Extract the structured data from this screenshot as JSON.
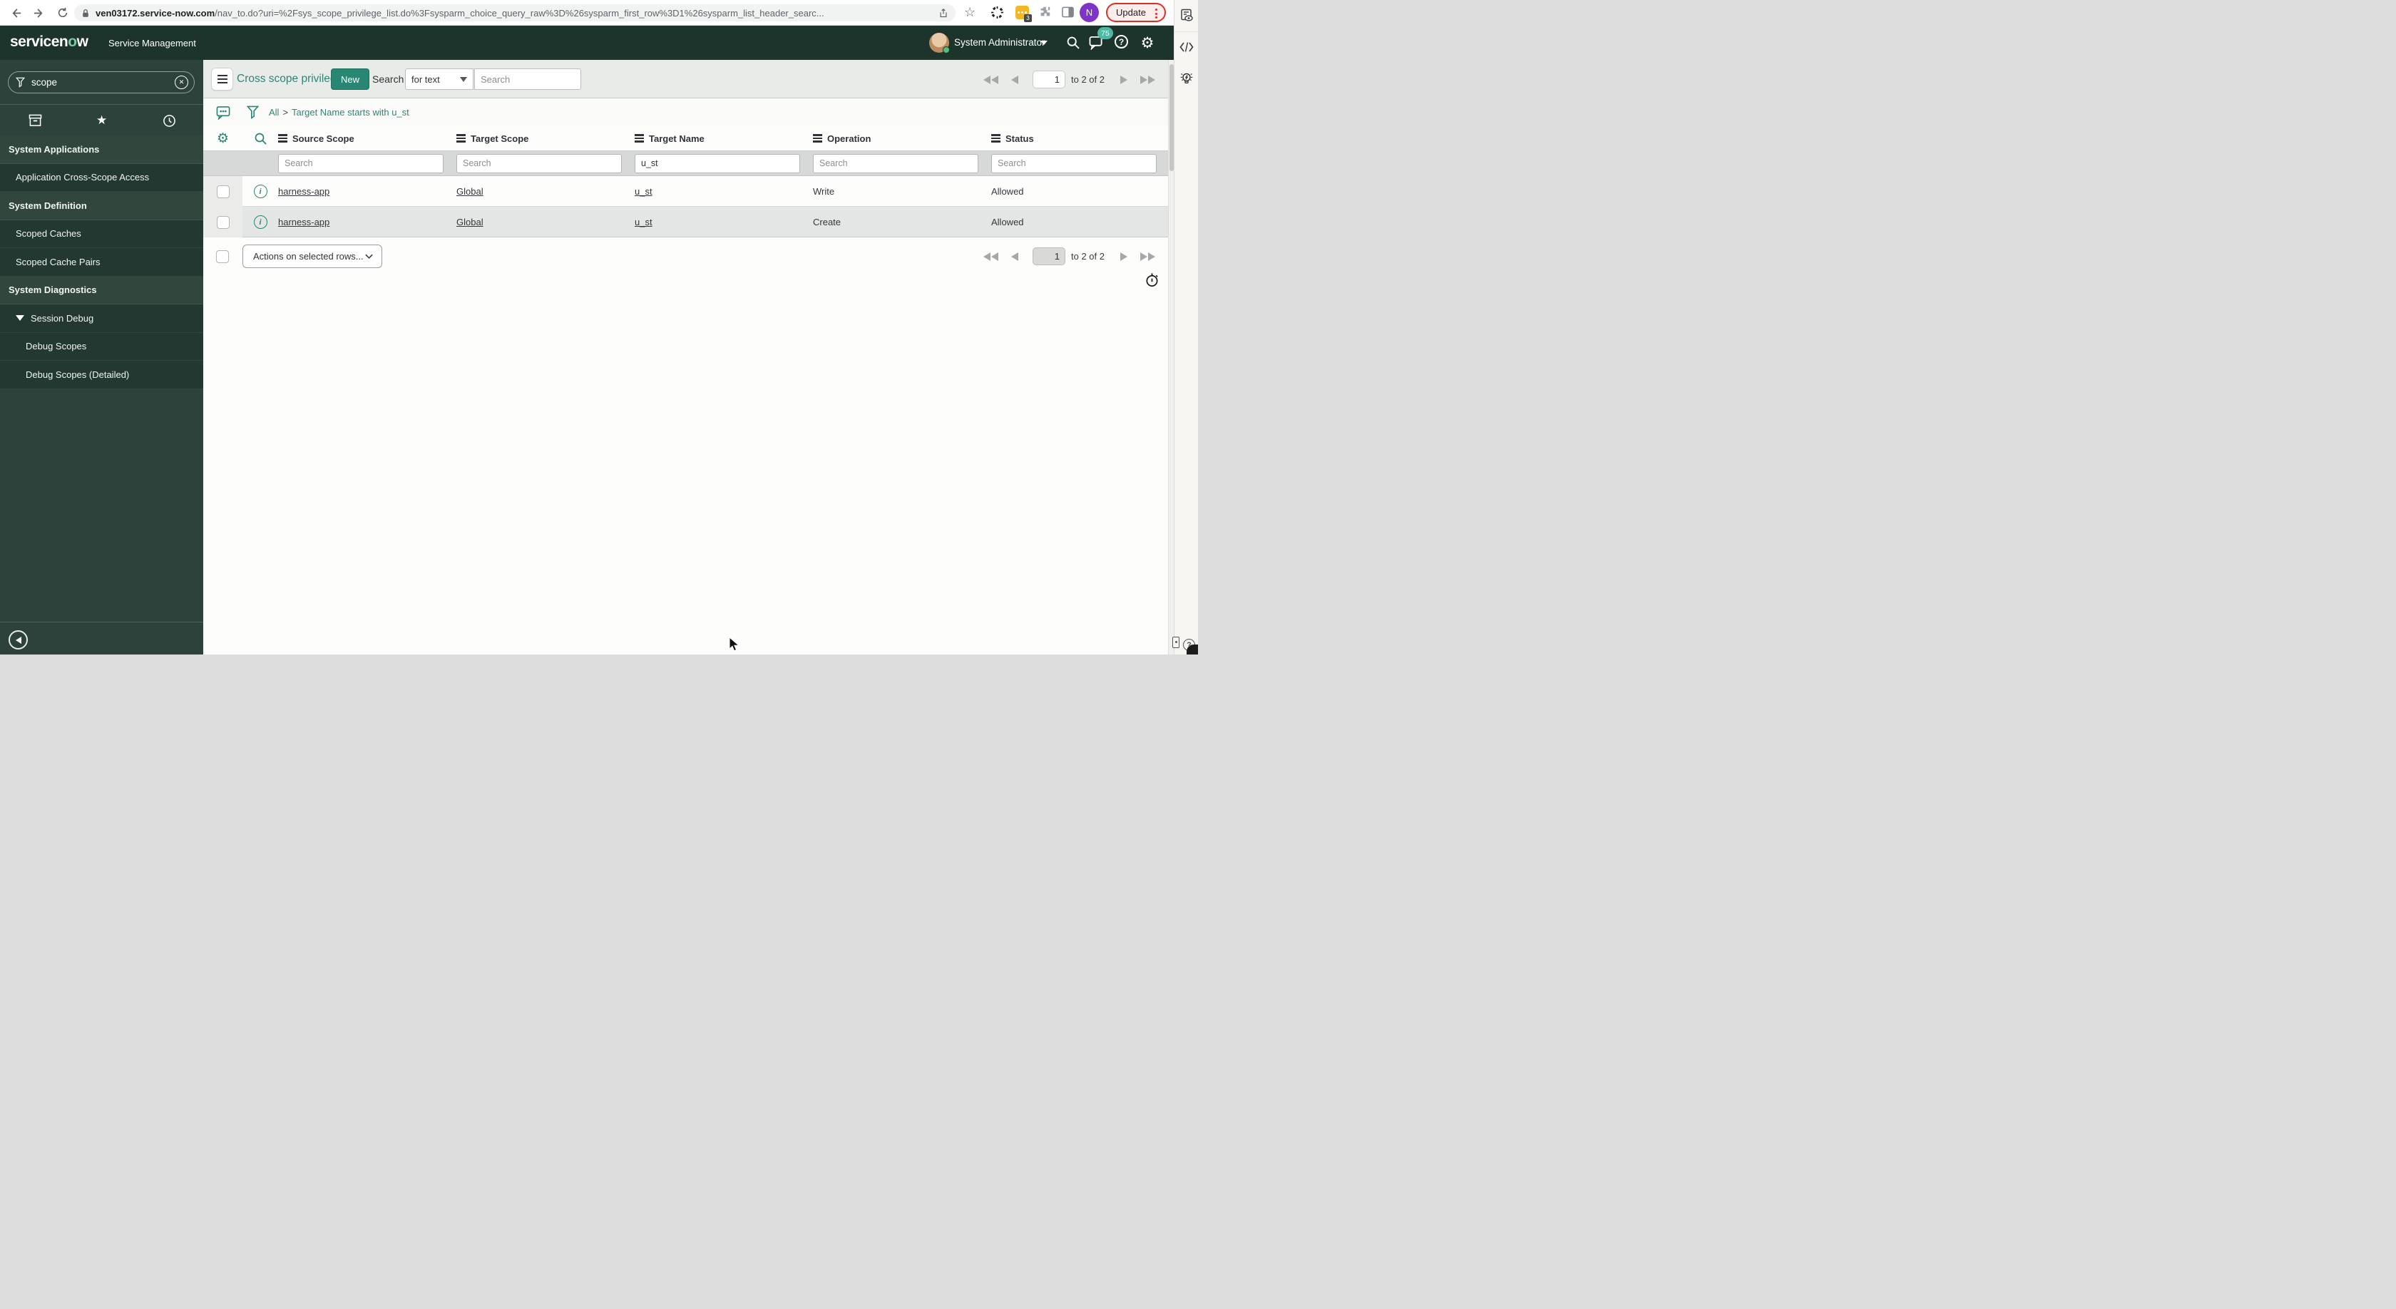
{
  "browser": {
    "url_host": "ven03172.service-now.com",
    "url_path": "/nav_to.do?uri=%2Fsys_scope_privilege_list.do%3Fsysparm_choice_query_raw%3D%26sysparm_first_row%3D1%26sysparm_list_header_searc...",
    "extension_badge": "3",
    "avatar_letter": "N",
    "update_label": "Update"
  },
  "app_header": {
    "logo_pre": "servicen",
    "logo_o": "o",
    "logo_post": "w",
    "product_name": "Service Management",
    "user_name": "System Administrator",
    "notification_count": "75"
  },
  "sidebar": {
    "filter_value": "scope",
    "items": [
      {
        "label": "System Applications",
        "type": "header"
      },
      {
        "label": "Application Cross-Scope Access",
        "type": "item"
      },
      {
        "label": "System Definition",
        "type": "header"
      },
      {
        "label": "Scoped Caches",
        "type": "item"
      },
      {
        "label": "Scoped Cache Pairs",
        "type": "item"
      },
      {
        "label": "System Diagnostics",
        "type": "header"
      },
      {
        "label": "Session Debug",
        "type": "expanded"
      },
      {
        "label": "Debug Scopes",
        "type": "subitem"
      },
      {
        "label": "Debug Scopes (Detailed)",
        "type": "subitem"
      }
    ]
  },
  "list_toolbar": {
    "title": "Cross scope privileges",
    "new_button": "New",
    "search_label": "Search",
    "search_type": "for text",
    "search_placeholder": "Search"
  },
  "pagination": {
    "page": "1",
    "range_text": "to 2 of 2"
  },
  "breadcrumb": {
    "root": "All",
    "separator": ">",
    "condition": "Target Name starts with u_st"
  },
  "list": {
    "columns": [
      "Source Scope",
      "Target Scope",
      "Target Name",
      "Operation",
      "Status"
    ],
    "filters": {
      "placeholder": "Search",
      "target_name_value": "u_st"
    },
    "rows": [
      {
        "source_scope": "harness-app",
        "target_scope": "Global",
        "target_name": "u_st",
        "operation": "Write",
        "status": "Allowed"
      },
      {
        "source_scope": "harness-app",
        "target_scope": "Global",
        "target_name": "u_st",
        "operation": "Create",
        "status": "Allowed"
      }
    ],
    "actions_placeholder": "Actions on selected rows..."
  },
  "colors": {
    "accent_teal": "#278772",
    "header_bg": "#1d342c",
    "sidebar_bg": "#2c423a",
    "link_teal": "#2e8575"
  }
}
